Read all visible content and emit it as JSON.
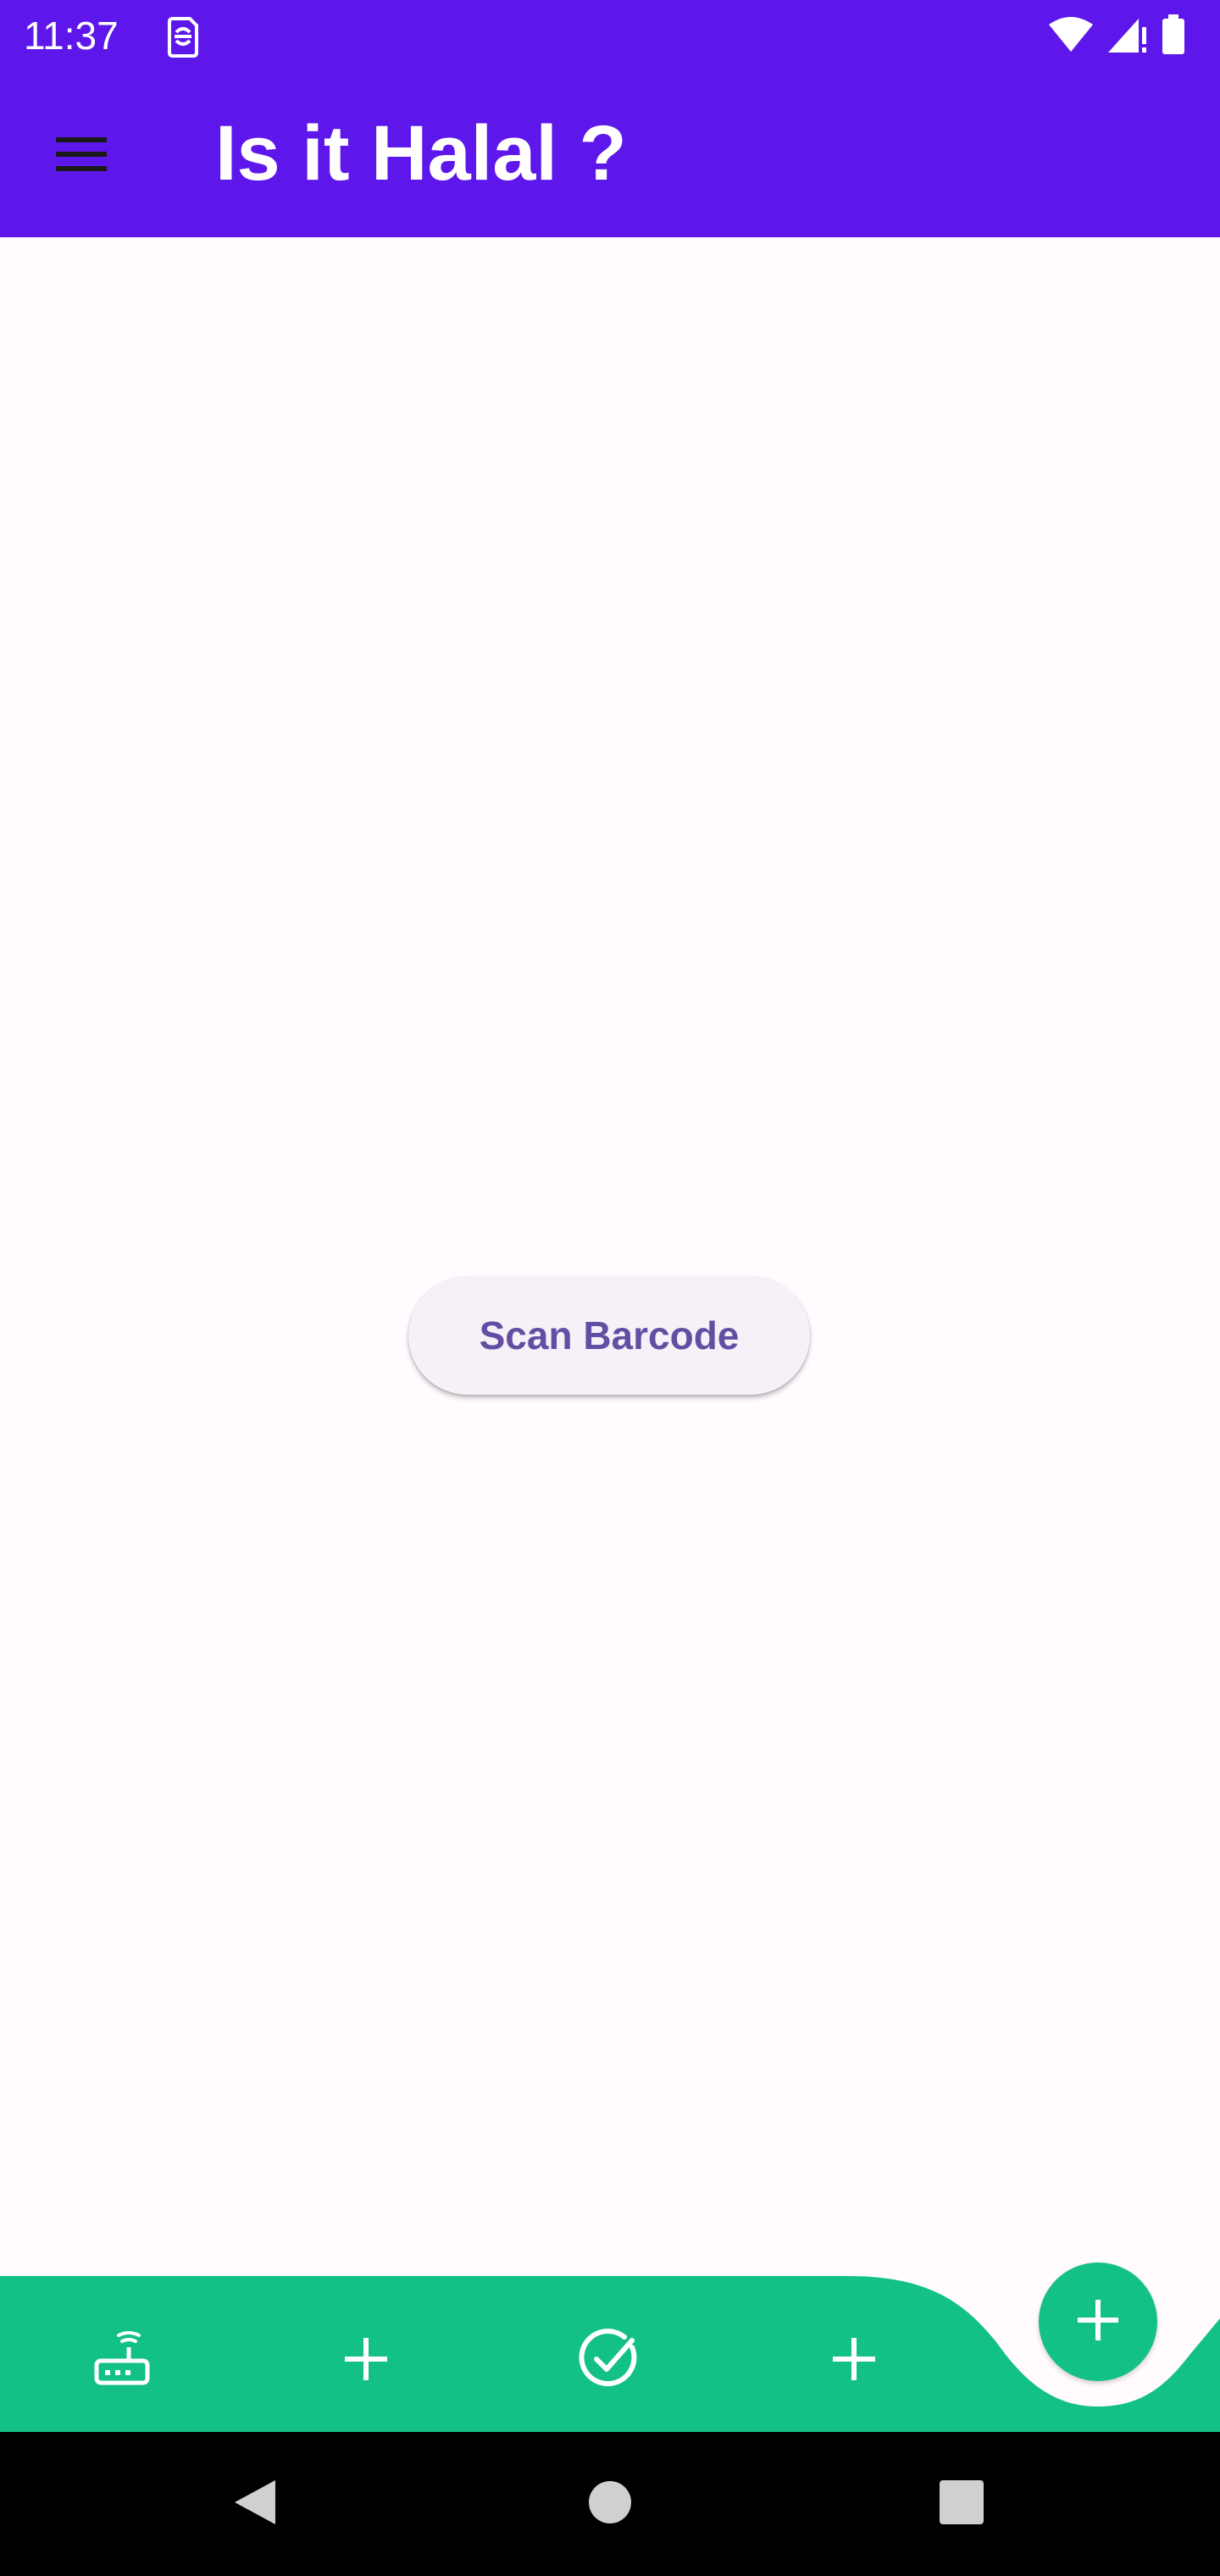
{
  "status_bar": {
    "time": "11:37",
    "icons": [
      "sim-card-icon",
      "wifi-icon",
      "cellular-signal-icon",
      "battery-icon"
    ]
  },
  "app_bar": {
    "title": "Is it Halal ?",
    "menu_icon": "hamburger-menu-icon",
    "background": "#5e17eb"
  },
  "main": {
    "scan_button_label": "Scan Barcode"
  },
  "bottom_nav": {
    "background": "#13c185",
    "items": [
      {
        "icon": "router-icon"
      },
      {
        "icon": "add-icon"
      },
      {
        "icon": "check-circle-icon"
      },
      {
        "icon": "add-icon"
      }
    ],
    "fab_icon": "add-icon"
  },
  "system_nav": {
    "buttons": [
      "back-icon",
      "home-icon",
      "recents-icon"
    ]
  },
  "colors": {
    "accent": "#5e17eb",
    "bottom_bar": "#13c185",
    "button_text": "#644ea3"
  }
}
